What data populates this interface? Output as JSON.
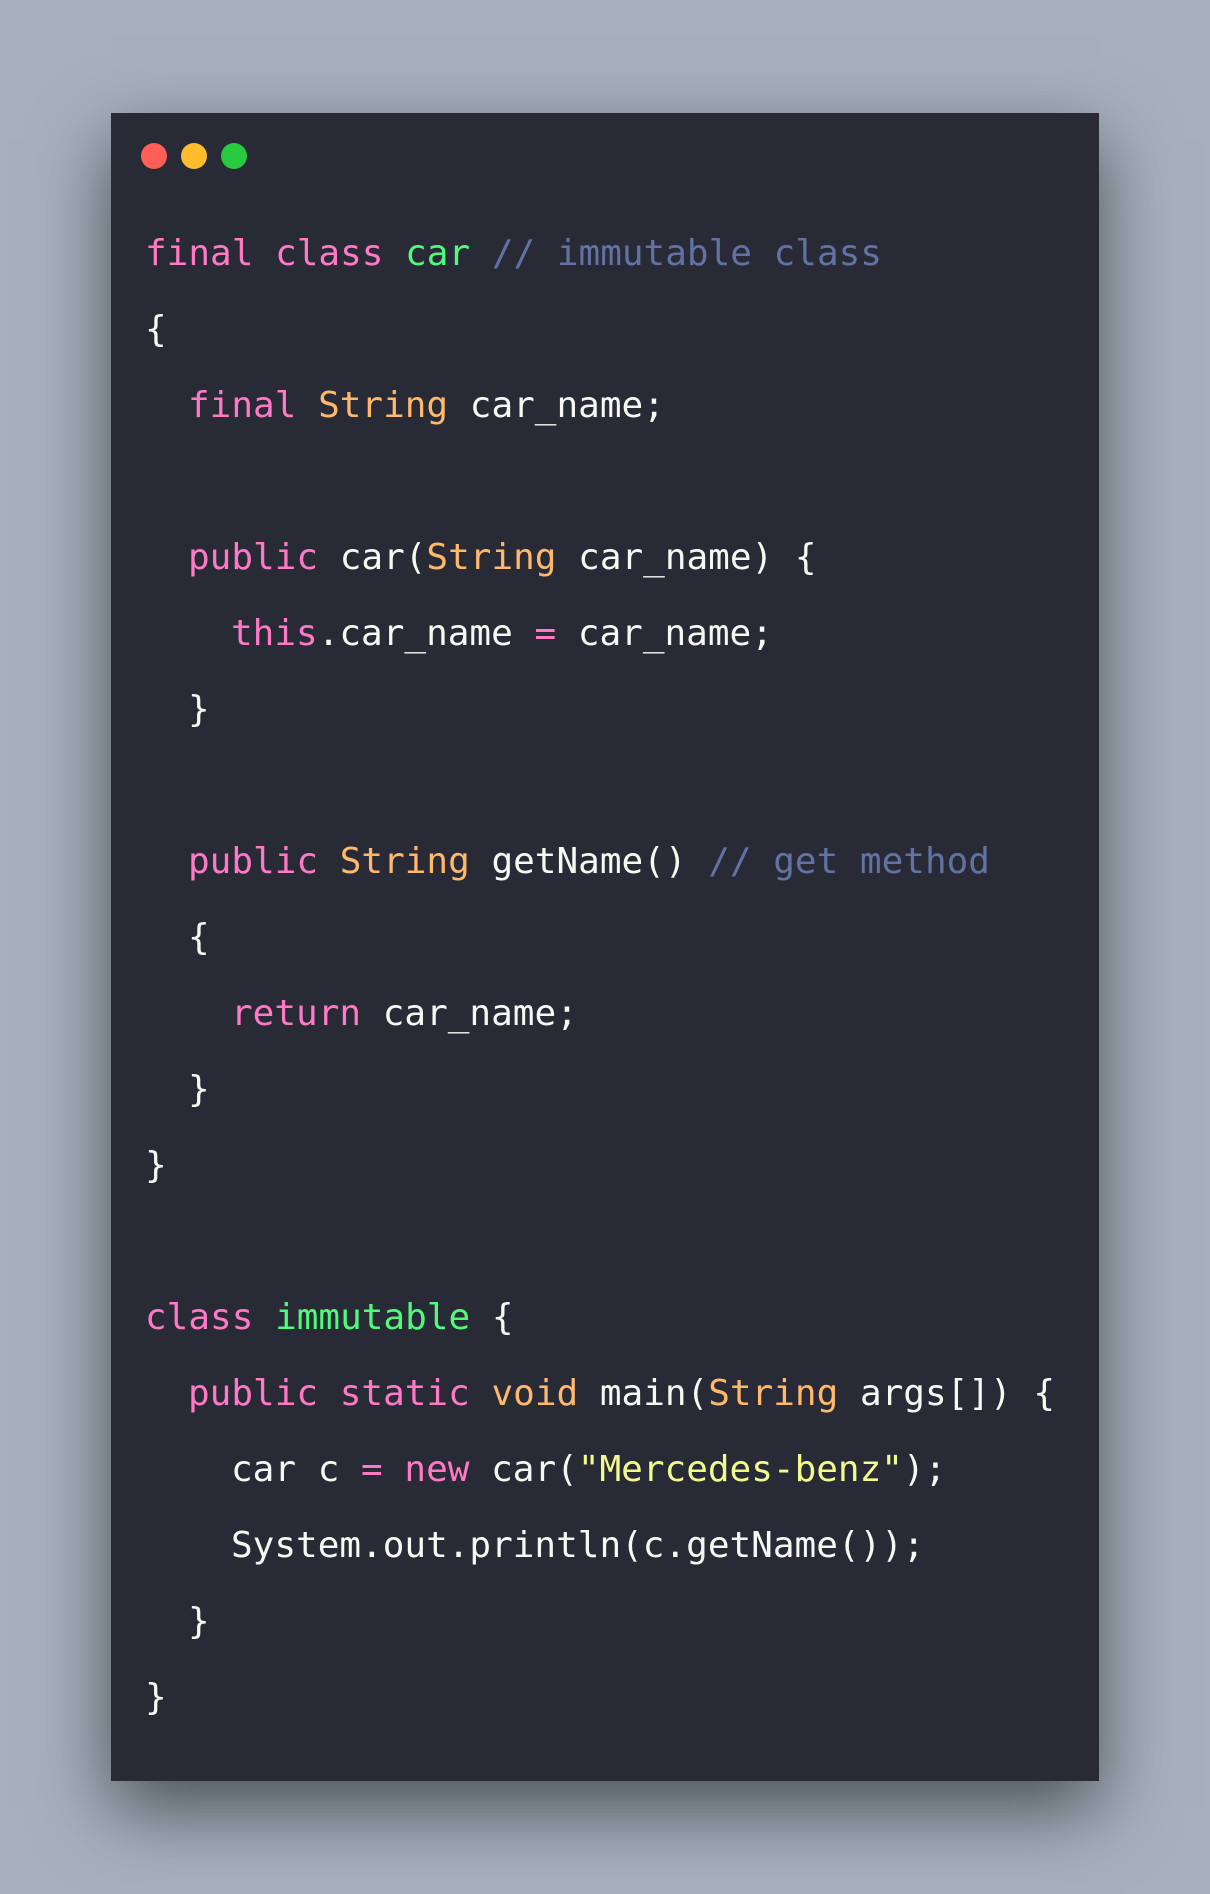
{
  "theme": {
    "background": "#a6b1bd",
    "editor_background": "#282a36",
    "keyword": "#ff79c6",
    "type": "#ffb86c",
    "class_name": "#50fa7b",
    "comment": "#6272a4",
    "string": "#f1fa8c",
    "text": "#f8f8f2"
  },
  "window": {
    "buttons": [
      {
        "name": "close",
        "color": "#ff5f56"
      },
      {
        "name": "minimize",
        "color": "#ffbd2e"
      },
      {
        "name": "maximize",
        "color": "#27c93f"
      }
    ]
  },
  "code": {
    "lines": [
      {
        "indent": 0,
        "tokens": [
          [
            "kw",
            "final"
          ],
          [
            "plain",
            " "
          ],
          [
            "kw",
            "class"
          ],
          [
            "plain",
            " "
          ],
          [
            "cls",
            "car"
          ],
          [
            "plain",
            " "
          ],
          [
            "cmt",
            "// immutable class"
          ]
        ]
      },
      {
        "indent": 0,
        "tokens": [
          [
            "plain",
            "{"
          ]
        ]
      },
      {
        "indent": 1,
        "tokens": [
          [
            "kw",
            "final"
          ],
          [
            "plain",
            " "
          ],
          [
            "type",
            "String"
          ],
          [
            "plain",
            " car_name;"
          ]
        ]
      },
      {
        "indent": 0,
        "tokens": []
      },
      {
        "indent": 1,
        "tokens": [
          [
            "kw",
            "public"
          ],
          [
            "plain",
            " car("
          ],
          [
            "type",
            "String"
          ],
          [
            "plain",
            " car_name) {"
          ]
        ]
      },
      {
        "indent": 2,
        "tokens": [
          [
            "kw",
            "this"
          ],
          [
            "plain",
            ".car_name "
          ],
          [
            "kw",
            "="
          ],
          [
            "plain",
            " car_name;"
          ]
        ]
      },
      {
        "indent": 1,
        "tokens": [
          [
            "plain",
            "}"
          ]
        ]
      },
      {
        "indent": 0,
        "tokens": []
      },
      {
        "indent": 1,
        "tokens": [
          [
            "kw",
            "public"
          ],
          [
            "plain",
            " "
          ],
          [
            "type",
            "String"
          ],
          [
            "plain",
            " getName() "
          ],
          [
            "cmt",
            "// get method"
          ]
        ]
      },
      {
        "indent": 1,
        "tokens": [
          [
            "plain",
            "{"
          ]
        ]
      },
      {
        "indent": 2,
        "tokens": [
          [
            "kw",
            "return"
          ],
          [
            "plain",
            " car_name;"
          ]
        ]
      },
      {
        "indent": 1,
        "tokens": [
          [
            "plain",
            "}"
          ]
        ]
      },
      {
        "indent": 0,
        "tokens": [
          [
            "plain",
            "}"
          ]
        ]
      },
      {
        "indent": 0,
        "tokens": []
      },
      {
        "indent": 0,
        "tokens": [
          [
            "kw",
            "class"
          ],
          [
            "plain",
            " "
          ],
          [
            "cls",
            "immutable"
          ],
          [
            "plain",
            " {"
          ]
        ]
      },
      {
        "indent": 1,
        "tokens": [
          [
            "kw",
            "public"
          ],
          [
            "plain",
            " "
          ],
          [
            "kw",
            "static"
          ],
          [
            "plain",
            " "
          ],
          [
            "type",
            "void"
          ],
          [
            "plain",
            " main("
          ],
          [
            "type",
            "String"
          ],
          [
            "plain",
            " args[]) {"
          ]
        ]
      },
      {
        "indent": 2,
        "tokens": [
          [
            "plain",
            "car c "
          ],
          [
            "kw",
            "="
          ],
          [
            "plain",
            " "
          ],
          [
            "kw",
            "new"
          ],
          [
            "plain",
            " car("
          ],
          [
            "str",
            "\"Mercedes-benz\""
          ],
          [
            "plain",
            ");"
          ]
        ]
      },
      {
        "indent": 2,
        "tokens": [
          [
            "plain",
            "System.out.println(c.getName());"
          ]
        ]
      },
      {
        "indent": 1,
        "tokens": [
          [
            "plain",
            "}"
          ]
        ]
      },
      {
        "indent": 0,
        "tokens": [
          [
            "plain",
            "}"
          ]
        ]
      }
    ]
  }
}
